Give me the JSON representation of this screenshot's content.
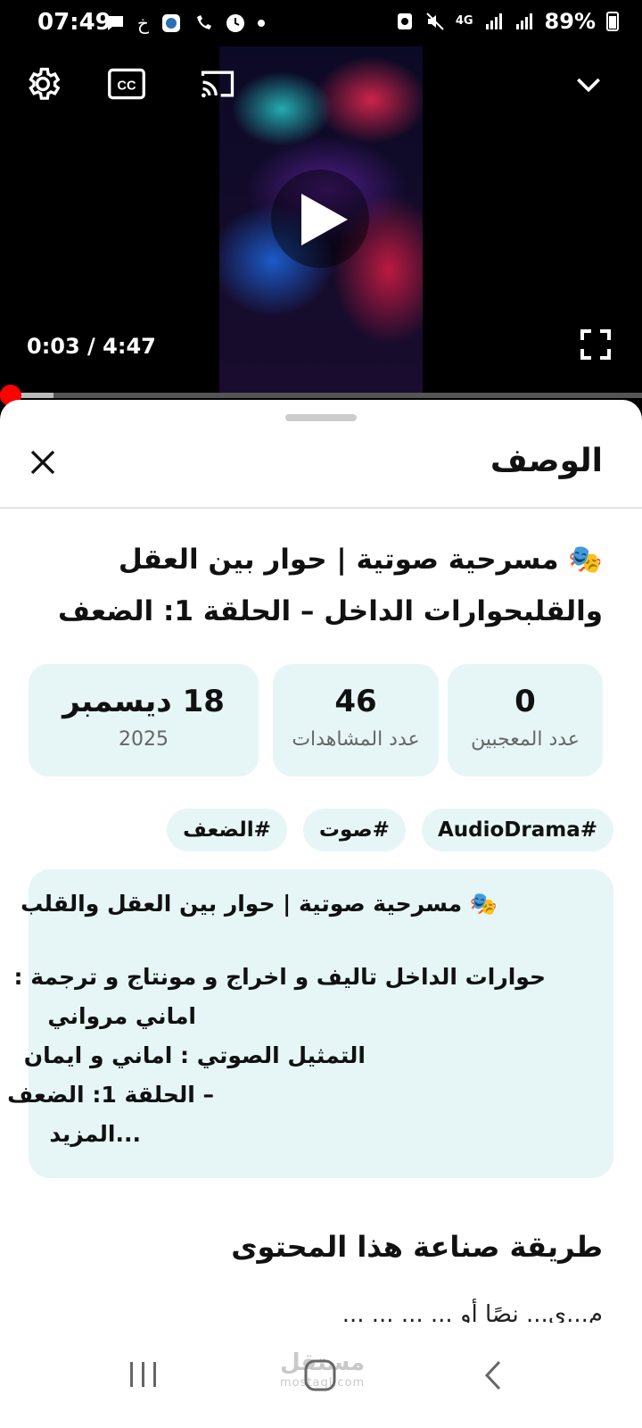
{
  "status_bar": {
    "time": "07:49",
    "battery": "89%",
    "icons": [
      "message-icon",
      "app-icon",
      "globe-app-icon",
      "call-forward-icon",
      "clock-icon",
      "dot-icon",
      "recycle-icon",
      "mute-icon",
      "signal-4g-icon",
      "signal-icon",
      "signal-icon",
      "battery-icon"
    ]
  },
  "player": {
    "time_readout": "0:03 / 4:47",
    "progress_fraction": 0.0106
  },
  "sheet": {
    "title": "الوصف",
    "video_title_line1": "🎭 مسرحية صوتية | حوار بين العقل",
    "video_title_line2": "والقلبحوارات الداخل – الحلقة 1: الضعف",
    "stats": [
      {
        "value": "0",
        "label": "عدد المعجبين"
      },
      {
        "value": "46",
        "label": "عدد المشاهدات"
      },
      {
        "value": "18 ديسمبر",
        "label": "2025"
      }
    ],
    "tags": [
      "#AudioDrama",
      "#صوت",
      "#الضعف"
    ],
    "description_lines": [
      "🎭 مسرحية صوتية | حوار بين العقل والقلب",
      "",
      "حوارات الداخل تاليف و اخراج و مونتاج و ترجمة :",
      "اماني مرواني",
      "التمثيل الصوتي : اماني و ايمان",
      "– الحلقة 1: الضعف",
      "...المزيد"
    ],
    "section_title": "طريقة صناعة هذا المحتوى",
    "cut_line": "م...ي... نصًا أو ... ... ... ..."
  },
  "watermark": {
    "brand": "مستقل",
    "domain": "mostaql.com"
  }
}
